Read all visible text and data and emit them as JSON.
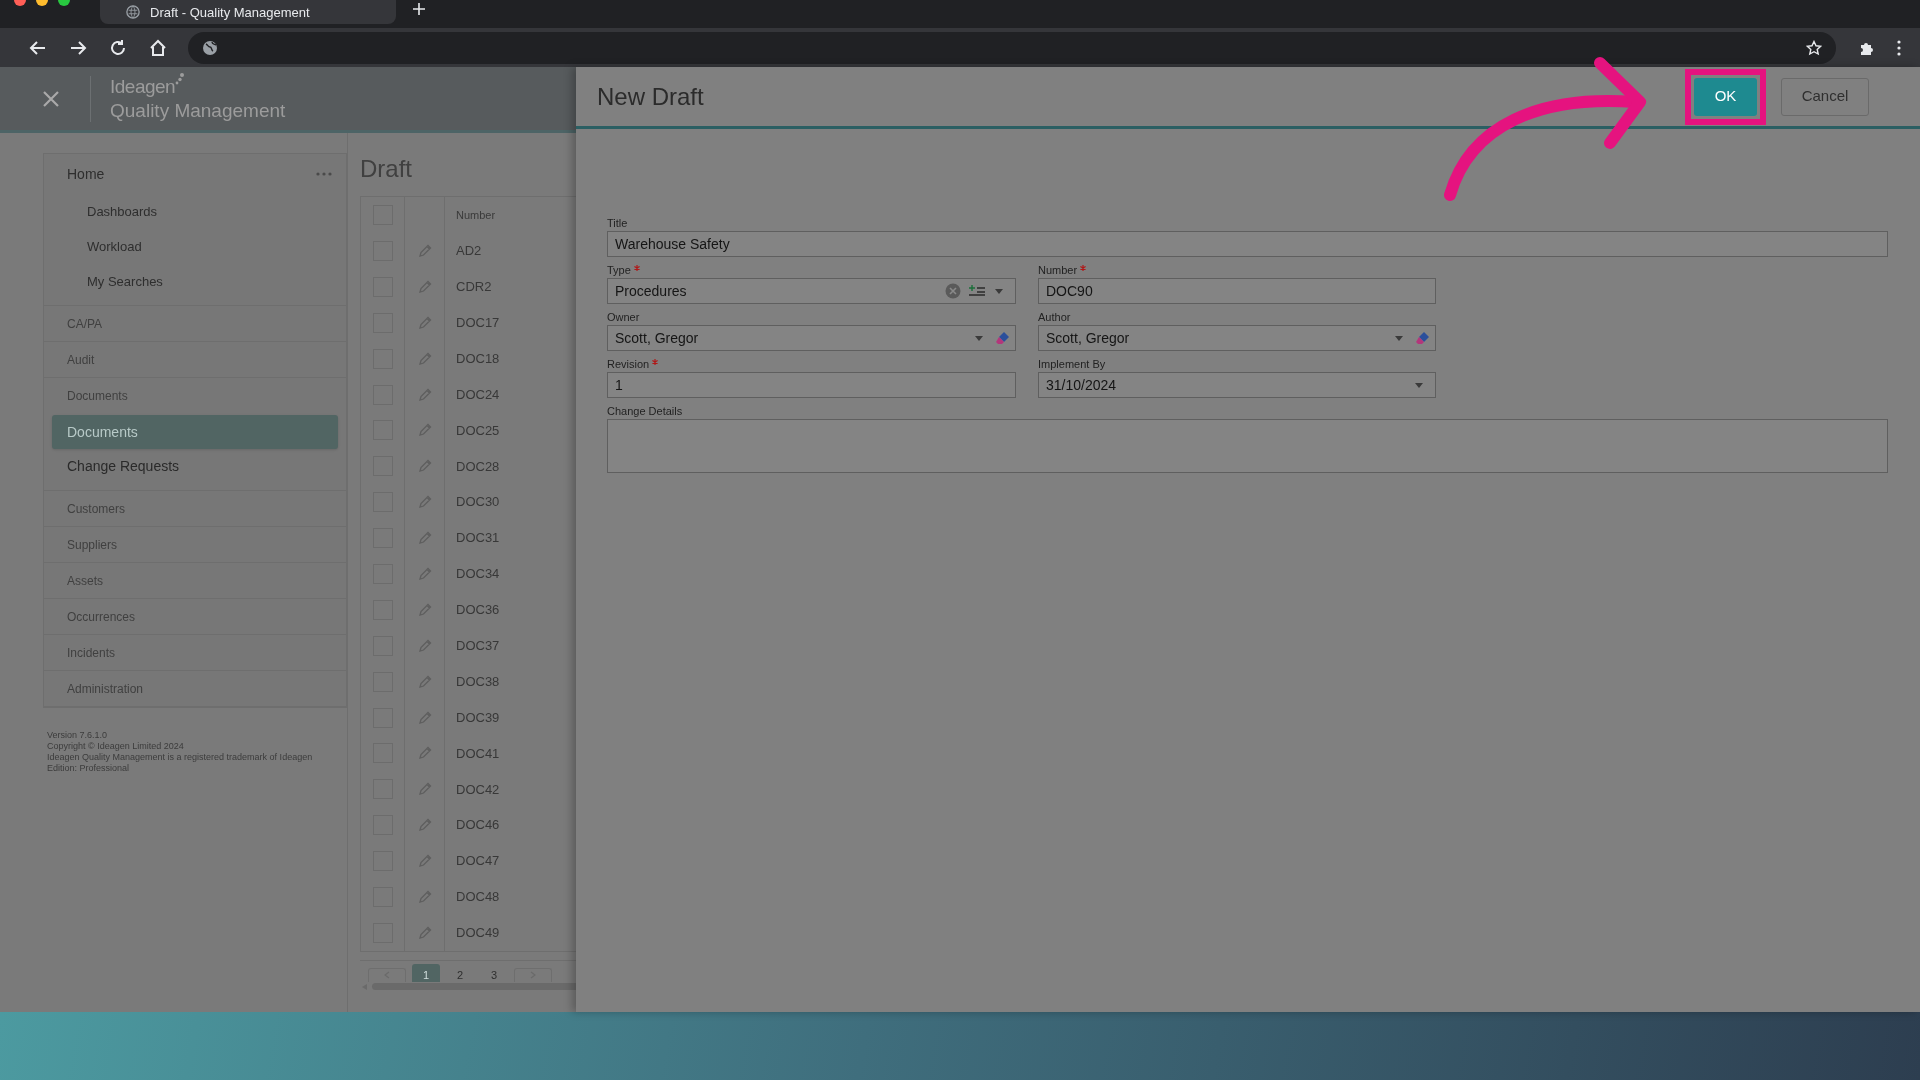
{
  "browser": {
    "tab_title": "Draft - Quality Management"
  },
  "app_header": {
    "brand": "Ideagen",
    "product": "Quality Management"
  },
  "sidebar": {
    "items": [
      {
        "label": "Home",
        "kind": "home",
        "children": [
          {
            "label": "Dashboards",
            "selected": false
          },
          {
            "label": "Workload",
            "selected": false
          },
          {
            "label": "My Searches",
            "selected": false
          }
        ]
      },
      {
        "label": "CA/PA",
        "kind": "module"
      },
      {
        "label": "Audit",
        "kind": "module"
      },
      {
        "label": "Documents",
        "kind": "module",
        "children": [
          {
            "label": "Documents",
            "selected": true
          },
          {
            "label": "Change Requests",
            "selected": false
          }
        ]
      },
      {
        "label": "Customers",
        "kind": "module"
      },
      {
        "label": "Suppliers",
        "kind": "module"
      },
      {
        "label": "Assets",
        "kind": "module"
      },
      {
        "label": "Occurrences",
        "kind": "module"
      },
      {
        "label": "Incidents",
        "kind": "module"
      },
      {
        "label": "Administration",
        "kind": "module"
      }
    ],
    "footer": [
      "Version 7.6.1.0",
      "Copyright © Ideagen Limited 2024",
      "Ideagen Quality Management is a registered trademark of Ideagen",
      "Edition: Professional"
    ]
  },
  "draft_list": {
    "title": "Draft",
    "column": "Number",
    "select_all_checked": false,
    "rows": [
      {
        "number": "AD2",
        "checked": false
      },
      {
        "number": "CDR2",
        "checked": false
      },
      {
        "number": "DOC17",
        "checked": false
      },
      {
        "number": "DOC18",
        "checked": false
      },
      {
        "number": "DOC24",
        "checked": false
      },
      {
        "number": "DOC25",
        "checked": false
      },
      {
        "number": "DOC28",
        "checked": false
      },
      {
        "number": "DOC30",
        "checked": false
      },
      {
        "number": "DOC31",
        "checked": false
      },
      {
        "number": "DOC34",
        "checked": false
      },
      {
        "number": "DOC36",
        "checked": false
      },
      {
        "number": "DOC37",
        "checked": false
      },
      {
        "number": "DOC38",
        "checked": false
      },
      {
        "number": "DOC39",
        "checked": false
      },
      {
        "number": "DOC41",
        "checked": false
      },
      {
        "number": "DOC42",
        "checked": false
      },
      {
        "number": "DOC46",
        "checked": false
      },
      {
        "number": "DOC47",
        "checked": false
      },
      {
        "number": "DOC48",
        "checked": false
      },
      {
        "number": "DOC49",
        "checked": false
      }
    ],
    "pages": [
      {
        "label": "1",
        "selected": true
      },
      {
        "label": "2",
        "selected": false
      },
      {
        "label": "3",
        "selected": false
      }
    ]
  },
  "dialog": {
    "title": "New Draft",
    "buttons": [
      {
        "label": "OK",
        "kind": "primary",
        "highlighted": true
      },
      {
        "label": "Cancel",
        "kind": "secondary",
        "highlighted": false
      }
    ],
    "rows": [
      [
        {
          "label": "Title",
          "required": false,
          "value": "Warehouse Safety",
          "kind": "text"
        }
      ],
      [
        {
          "label": "Type",
          "required": true,
          "value": "Procedures",
          "kind": "lookup"
        },
        {
          "label": "Number",
          "required": true,
          "value": "DOC90",
          "kind": "text"
        }
      ],
      [
        {
          "label": "Owner",
          "required": false,
          "value": "Scott, Gregor",
          "kind": "user"
        },
        {
          "label": "Author",
          "required": false,
          "value": "Scott, Gregor",
          "kind": "user"
        }
      ],
      [
        {
          "label": "Revision",
          "required": true,
          "value": "1",
          "kind": "text"
        },
        {
          "label": "Implement By",
          "required": false,
          "value": "31/10/2024",
          "kind": "date"
        }
      ],
      [
        {
          "label": "Change Details",
          "required": false,
          "kind": "textarea"
        }
      ]
    ]
  }
}
